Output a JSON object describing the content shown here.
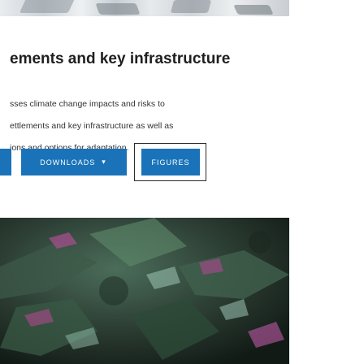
{
  "page": {
    "title": "ements and key infrastructure",
    "description_lines": [
      "sses climate change impacts and risks to",
      "ettlements and key infrastructure as well as",
      "ions and options for adaptation."
    ]
  },
  "buttons": {
    "downloads_label": "DOWNLOADS",
    "downloads_caret": "▾",
    "figures_label": "FIGURES"
  },
  "colors": {
    "button_bg": "#1a73b8",
    "focus_border": "#2a2a2a"
  }
}
